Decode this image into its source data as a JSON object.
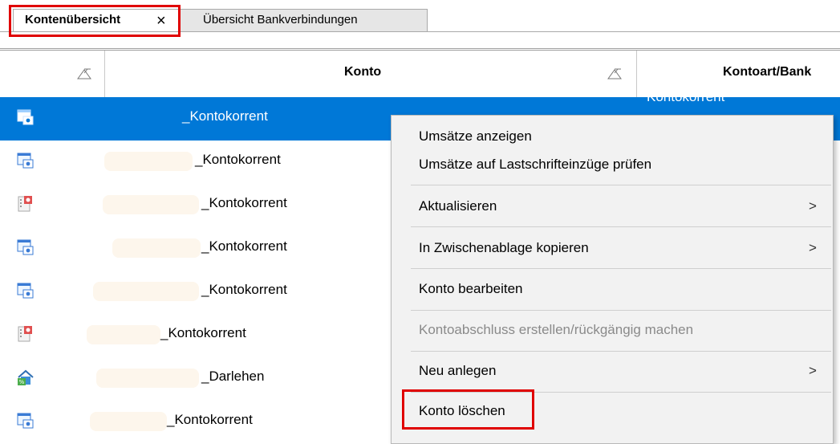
{
  "tabs": [
    {
      "label": "Kontenübersicht",
      "close": "×"
    },
    {
      "label": "Übersicht Bankverbindungen"
    }
  ],
  "columns": [
    "Konto",
    "Kontoart/Bank"
  ],
  "rows": [
    {
      "konto": "_Kontokorrent",
      "kontoart": "Kontokorrent",
      "icon": "bank-account-icon",
      "selected": true
    },
    {
      "konto": "_Kontokorrent",
      "icon": "bank-account-icon"
    },
    {
      "konto": "_Kontokorrent",
      "icon": "credit-card-icon"
    },
    {
      "konto": "_Kontokorrent",
      "icon": "bank-account-icon"
    },
    {
      "konto": "_Kontokorrent",
      "icon": "bank-account-icon"
    },
    {
      "konto": "_Kontokorrent",
      "icon": "credit-card-icon"
    },
    {
      "konto": "_Darlehen",
      "icon": "house-loan-icon"
    },
    {
      "konto": "_Kontokorrent",
      "icon": "bank-account-icon"
    }
  ],
  "context_menu": [
    {
      "label": "Umsätze anzeigen"
    },
    {
      "label": "Umsätze auf Lastschrifteinzüge prüfen"
    },
    {
      "label": "Aktualisieren",
      "submenu": ">"
    },
    {
      "label": "In Zwischenablage kopieren",
      "submenu": ">"
    },
    {
      "label": "Konto bearbeiten"
    },
    {
      "label": "Kontoabschluss erstellen/rückgängig machen",
      "disabled": true
    },
    {
      "label": "Neu anlegen",
      "submenu": ">"
    },
    {
      "label": "Konto löschen",
      "highlighted": true
    }
  ],
  "colors": {
    "selection": "#0078d7",
    "highlight_box": "#e00000",
    "menu_bg": "#f2f2f2"
  }
}
